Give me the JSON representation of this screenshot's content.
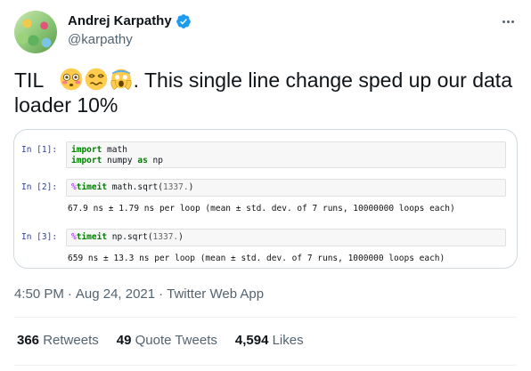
{
  "author": {
    "display_name": "Andrej Karpathy",
    "handle": "@karpathy",
    "verified": true,
    "avatar_icon": "avatar-image"
  },
  "tweet": {
    "text_prefix": "TIL",
    "emojis": [
      "flushed-face-emoji",
      "woozy-face-emoji",
      "screaming-face-emoji"
    ],
    "text_body": ". This single line change sped up our data loader 10%"
  },
  "notebook": {
    "cells": [
      {
        "prompt": "In [1]:",
        "lines": [
          "import math",
          "import numpy as np"
        ],
        "output": ""
      },
      {
        "prompt": "In [2]:",
        "code": "%timeit math.sqrt(1337.)",
        "output": "67.9 ns ± 1.79 ns per loop (mean ± std. dev. of 7 runs, 10000000 loops each)"
      },
      {
        "prompt": "In [3]:",
        "code": "%timeit np.sqrt(1337.)",
        "output": "659 ns ± 13.3 ns per loop (mean ± std. dev. of 7 runs, 1000000 loops each)"
      }
    ]
  },
  "meta": {
    "time": "4:50 PM",
    "date": "Aug 24, 2021",
    "source": "Twitter Web App",
    "separator": "·"
  },
  "stats": {
    "retweets_count": "366",
    "retweets_label": "Retweets",
    "quotes_count": "49",
    "quotes_label": "Quote Tweets",
    "likes_count": "4,594",
    "likes_label": "Likes"
  },
  "colors": {
    "verified": "#1d9bf0",
    "secondary_text": "#536471",
    "border": "#cfd9de"
  }
}
